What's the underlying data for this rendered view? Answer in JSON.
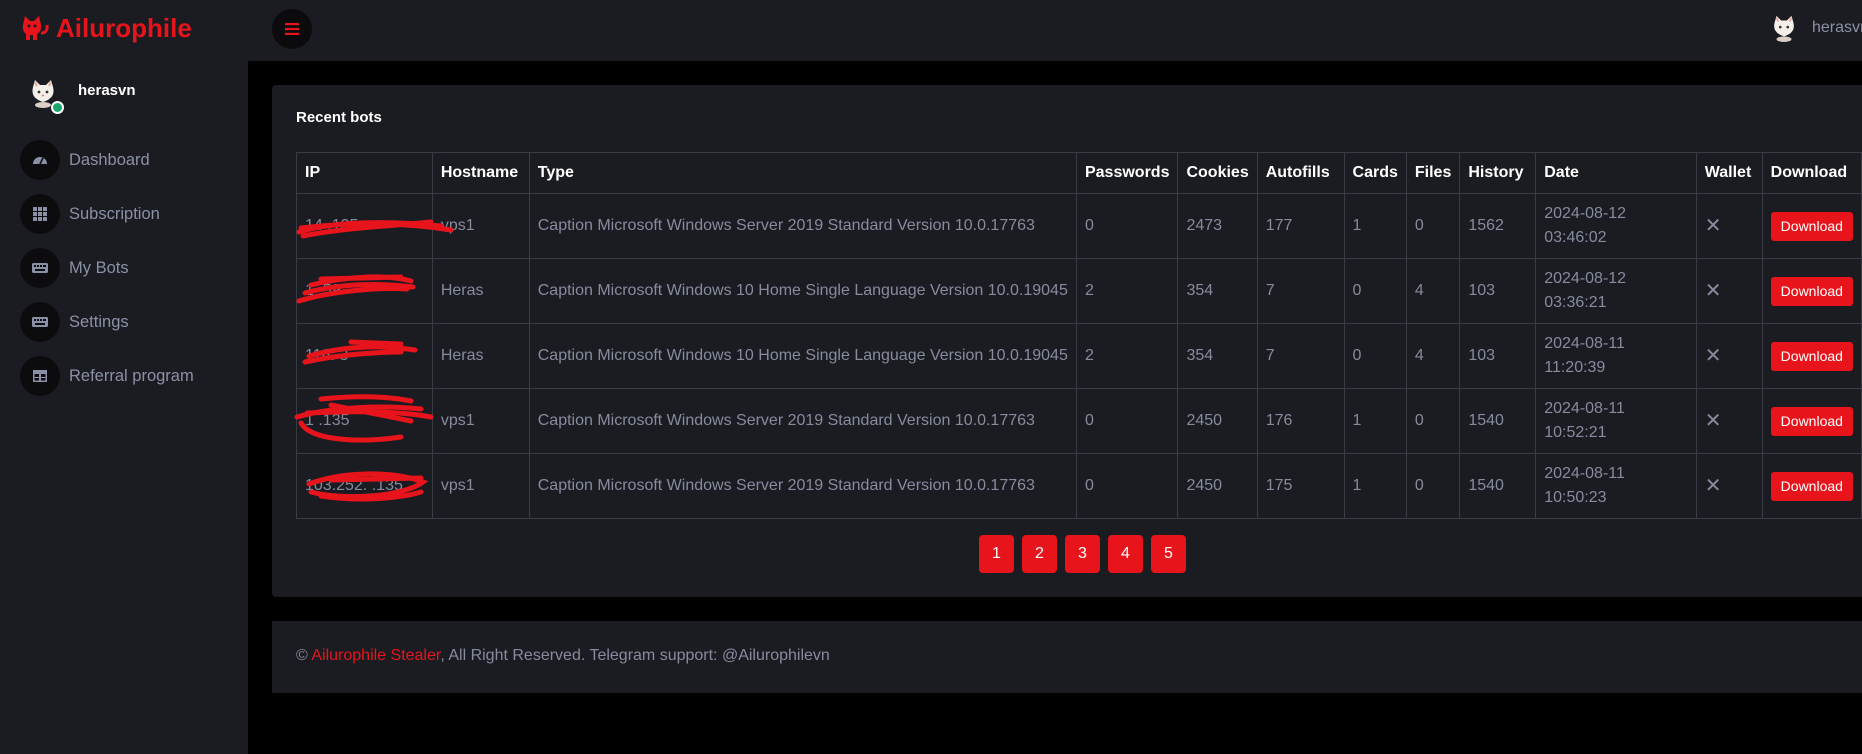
{
  "brand": {
    "name": "Ailurophile"
  },
  "user": {
    "name": "herasvn"
  },
  "sidebar": {
    "items": [
      {
        "label": "Dashboard",
        "icon": "dashboard-icon"
      },
      {
        "label": "Subscription",
        "icon": "grid-icon"
      },
      {
        "label": "My Bots",
        "icon": "keyboard-icon"
      },
      {
        "label": "Settings",
        "icon": "keyboard-icon"
      },
      {
        "label": "Referral program",
        "icon": "table-icon"
      }
    ]
  },
  "topbar": {
    "user_name": "herasvn"
  },
  "card": {
    "title": "Recent bots"
  },
  "table": {
    "columns": [
      "IP",
      "Hostname",
      "Type",
      "Passwords",
      "Cookies",
      "Autofills",
      "Cards",
      "Files",
      "History",
      "Date",
      "Wallet",
      "Download"
    ],
    "rows": [
      {
        "ip": "14 .135",
        "hostname": "vps1",
        "type": "Caption Microsoft Windows Server 2019 Standard Version 10.0.17763",
        "passwords": "0",
        "cookies": "2473",
        "autofills": "177",
        "cards": "1",
        "files": "0",
        "history": "1562",
        "date": "2024-08-12",
        "time": "03:46:02",
        "wallet": "✕",
        "download": "Download"
      },
      {
        "ip": "1 .59",
        "hostname": "Heras",
        "type": "Caption Microsoft Windows 10 Home Single Language Version 10.0.19045",
        "passwords": "2",
        "cookies": "354",
        "autofills": "7",
        "cards": "0",
        "files": "4",
        "history": "103",
        "date": "2024-08-12",
        "time": "03:36:21",
        "wallet": "✕",
        "download": "Download"
      },
      {
        "ip": "116. 3",
        "hostname": "Heras",
        "type": "Caption Microsoft Windows 10 Home Single Language Version 10.0.19045",
        "passwords": "2",
        "cookies": "354",
        "autofills": "7",
        "cards": "0",
        "files": "4",
        "history": "103",
        "date": "2024-08-11",
        "time": "11:20:39",
        "wallet": "✕",
        "download": "Download"
      },
      {
        "ip": "1 .135",
        "hostname": "vps1",
        "type": "Caption Microsoft Windows Server 2019 Standard Version 10.0.17763",
        "passwords": "0",
        "cookies": "2450",
        "autofills": "176",
        "cards": "1",
        "files": "0",
        "history": "1540",
        "date": "2024-08-11",
        "time": "10:52:21",
        "wallet": "✕",
        "download": "Download"
      },
      {
        "ip": "103.252. .135",
        "hostname": "vps1",
        "type": "Caption Microsoft Windows Server 2019 Standard Version 10.0.17763",
        "passwords": "0",
        "cookies": "2450",
        "autofills": "175",
        "cards": "1",
        "files": "0",
        "history": "1540",
        "date": "2024-08-11",
        "time": "10:50:23",
        "wallet": "✕",
        "download": "Download"
      }
    ]
  },
  "pagination": {
    "pages": [
      "1",
      "2",
      "3",
      "4",
      "5"
    ]
  },
  "footer": {
    "copyright": "©",
    "link": "Ailurophile Stealer",
    "rest": ", All Right Reserved. Telegram support: @Ailurophilevn"
  },
  "colors": {
    "accent": "#e8141b",
    "panel": "#1b1c22",
    "background": "#000000",
    "muted_text": "#868b9e",
    "online": "#18a96a"
  }
}
